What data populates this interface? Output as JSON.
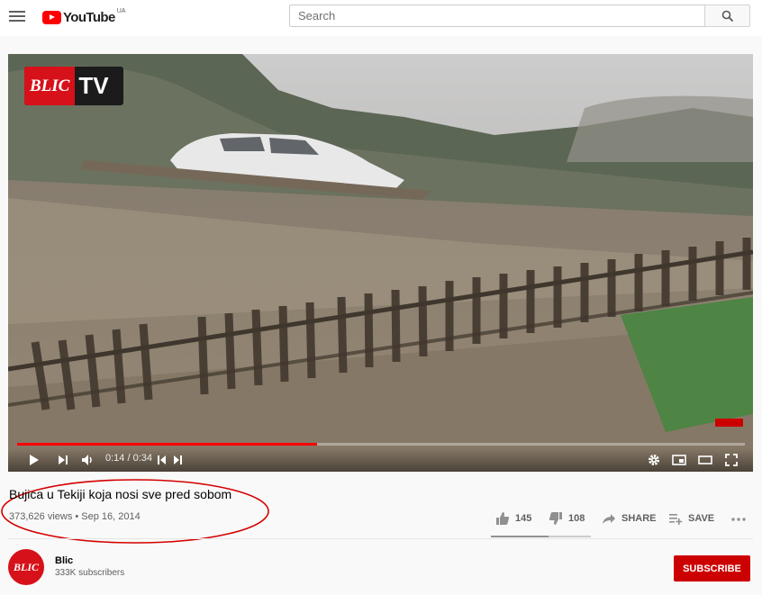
{
  "header": {
    "logo_text": "YouTube",
    "country_code": "UA",
    "search_placeholder": "Search"
  },
  "player": {
    "overlay_logo_left": "BLIC",
    "overlay_logo_right": "TV",
    "current_time": "0:14",
    "duration": "0:34",
    "time_separator": " / ",
    "progress_fraction": 0.412,
    "icons": [
      "play-icon",
      "next-icon",
      "volume-icon",
      "chapter-prev-icon",
      "chapter-next-icon",
      "settings-gear-icon",
      "miniplayer-icon",
      "theater-mode-icon",
      "fullscreen-icon"
    ]
  },
  "video": {
    "title": "Bujica u Tekiji koja nosi sve pred sobom",
    "views": "373,626 views",
    "separator": " • ",
    "date": "Sep 16, 2014",
    "likes": "145",
    "dislikes": "108",
    "like_fraction": 0.573,
    "share_label": "SHARE",
    "save_label": "SAVE"
  },
  "channel": {
    "name": "Blic",
    "avatar_text": "BLIC",
    "subscribers": "333K subscribers",
    "subscribe_label": "SUBSCRIBE"
  },
  "colors": {
    "brand_red": "#ff0000",
    "subscribe_red": "#cc0000",
    "blic_red": "#d6111a",
    "annotation_red": "#d40000"
  }
}
